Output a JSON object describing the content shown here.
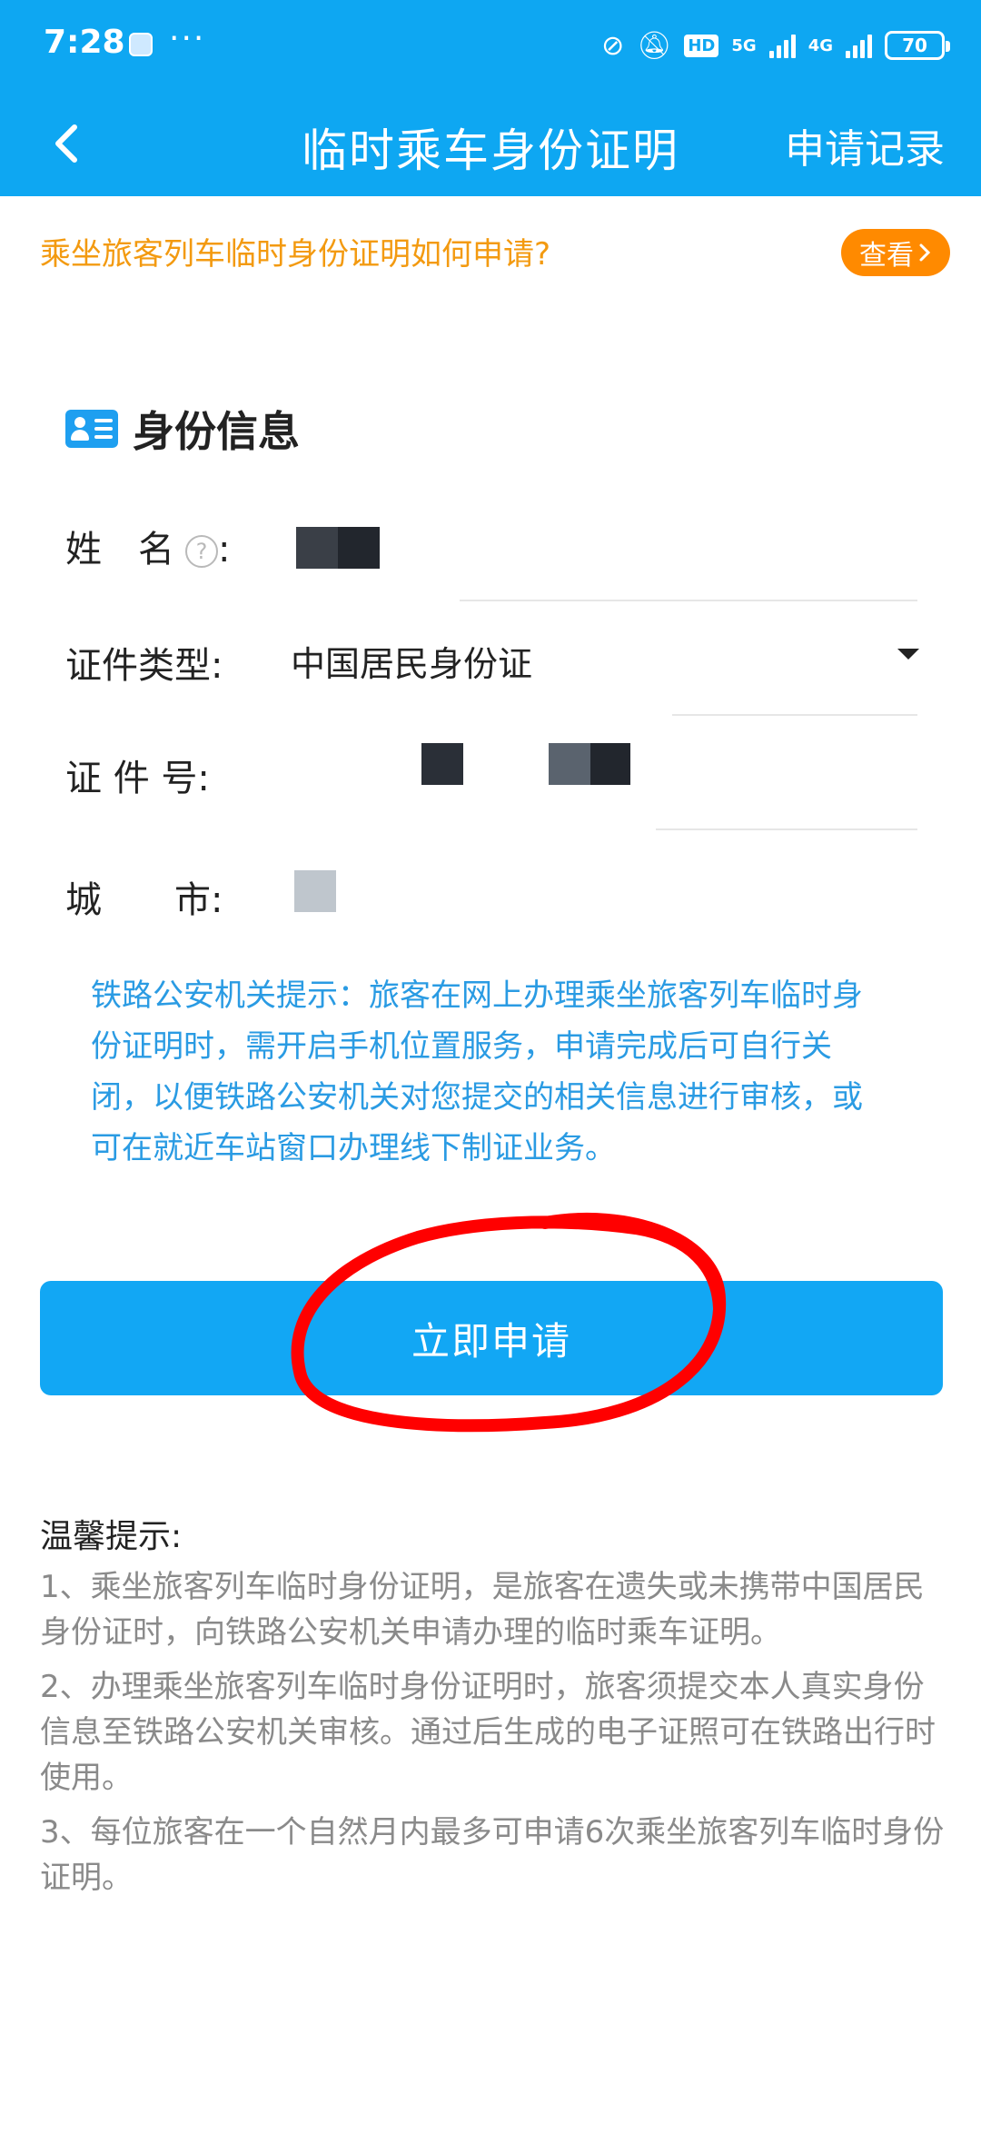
{
  "status_bar": {
    "time": "7:28",
    "more": "···",
    "hd": "HD",
    "net_5g": "5G",
    "net_4g": "4G",
    "battery": "70"
  },
  "nav": {
    "title": "临时乘车身份证明",
    "records_label": "申请记录"
  },
  "help_banner": {
    "question": "乘坐旅客列车临时身份证明如何申请?",
    "view_label": "查看"
  },
  "identity": {
    "section_title": "身份信息",
    "name_label": "姓　名",
    "name_help": "?",
    "colon": ":",
    "id_type_label": "证件类型:",
    "id_type_value": "中国居民身份证",
    "id_number_label": "证 件 号:",
    "city_label": "城　　市:"
  },
  "notice": "铁路公安机关提示：旅客在网上办理乘坐旅客列车临时身份证明时，需开启手机位置服务，申请完成后可自行关闭，以便铁路公安机关对您提交的相关信息进行审核，或可在就近车站窗口办理线下制证业务。",
  "apply_label": "立即申请",
  "tips": {
    "title": "温馨提示:",
    "items": [
      "1、乘坐旅客列车临时身份证明，是旅客在遗失或未携带中国居民身份证时，向铁路公安机关申请办理的临时乘车证明。",
      "2、办理乘坐旅客列车临时身份证明时，旅客须提交本人真实身份信息至铁路公安机关审核。通过后生成的电子证照可在铁路出行时使用。",
      "3、每位旅客在一个自然月内最多可申请6次乘坐旅客列车临时身份证明。"
    ]
  },
  "colors": {
    "header_blue": "#0ea7f2",
    "orange": "#ff8a00",
    "notice_blue": "#2a9be3",
    "annotation_red": "#ff0000"
  }
}
